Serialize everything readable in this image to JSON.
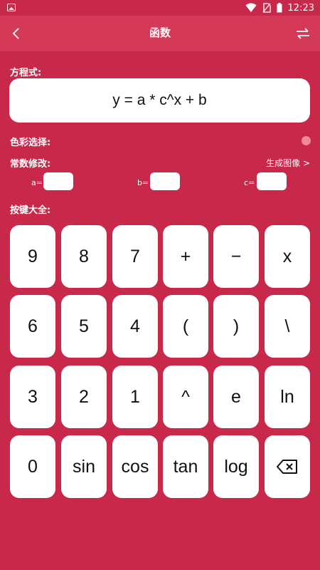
{
  "status": {
    "time": "12:23"
  },
  "header": {
    "title": "函数"
  },
  "labels": {
    "equation": "方程式:",
    "color": "色彩选择:",
    "constants": "常数修改:",
    "keys": "按键大全:"
  },
  "equation": {
    "value": "y = a * c^x + b"
  },
  "color_selected": "#f08a98",
  "generate_link": "生成图像 >",
  "constants": {
    "a": {
      "label": "a=",
      "value": ""
    },
    "b": {
      "label": "b=",
      "value": ""
    },
    "c": {
      "label": "c=",
      "value": ""
    }
  },
  "keys": {
    "row1": [
      "9",
      "8",
      "7",
      "+",
      "−",
      "x"
    ],
    "row2": [
      "6",
      "5",
      "4",
      "(",
      ")",
      "\\"
    ],
    "row3": [
      "3",
      "2",
      "1",
      "^",
      "e",
      "ln"
    ],
    "row4": [
      "0",
      "sin",
      "cos",
      "tan",
      "log",
      "backspace-icon"
    ]
  }
}
